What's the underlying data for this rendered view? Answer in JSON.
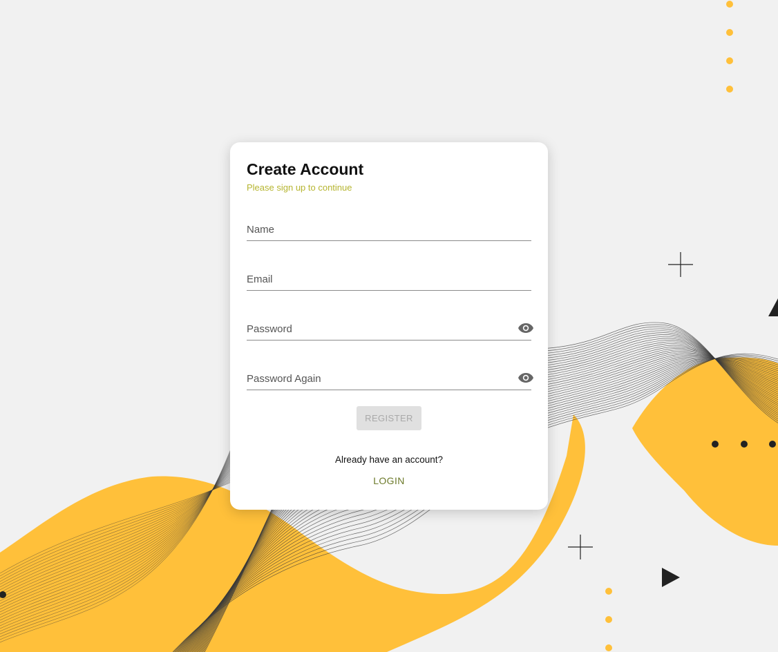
{
  "form": {
    "title": "Create Account",
    "subtitle": "Please sign up to continue",
    "fields": {
      "name": {
        "placeholder": "Name",
        "value": ""
      },
      "email": {
        "placeholder": "Email",
        "value": ""
      },
      "password": {
        "placeholder": "Password",
        "value": ""
      },
      "password_again": {
        "placeholder": "Password Again",
        "value": ""
      }
    },
    "register_label": "REGISTER",
    "login_prompt": "Already have an account?",
    "login_label": "LOGIN"
  },
  "icons": {
    "password_toggle": "eye-icon",
    "password_again_toggle": "eye-icon"
  },
  "colors": {
    "background": "#f1f1f1",
    "accent_yellow": "#ffc03a",
    "subtitle": "#b6b530",
    "login_link": "#6c7a2a",
    "register_disabled_bg": "#e0e0e0",
    "register_disabled_text": "#a9a9a9"
  }
}
